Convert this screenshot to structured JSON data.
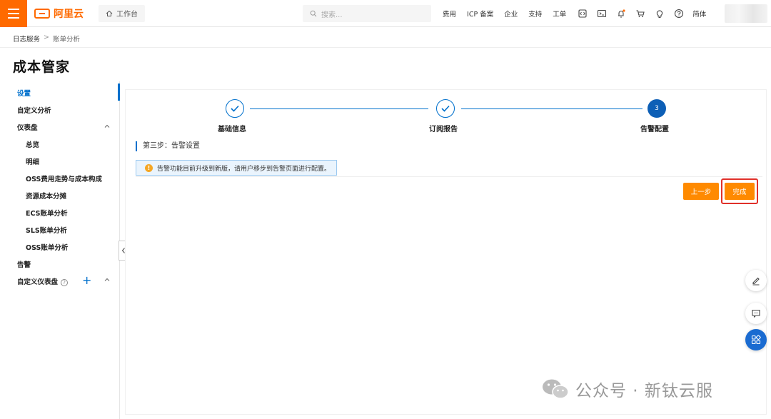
{
  "topbar": {
    "logo_text": "阿里云",
    "workbench": "工作台",
    "search_placeholder": "搜索...",
    "nav": [
      "费用",
      "ICP 备案",
      "企业",
      "支持",
      "工单"
    ],
    "lang": "简体"
  },
  "breadcrumb": {
    "root": "日志服务",
    "current": "账单分析"
  },
  "page_title": "成本管家",
  "sidebar": {
    "items": [
      {
        "label": "设置"
      },
      {
        "label": "自定义分析"
      },
      {
        "label": "仪表盘"
      },
      {
        "label": "总览"
      },
      {
        "label": "明细"
      },
      {
        "label": "OSS费用走势与成本构成"
      },
      {
        "label": "资源成本分摊"
      },
      {
        "label": "ECS账单分析"
      },
      {
        "label": "SLS账单分析"
      },
      {
        "label": "OSS账单分析"
      },
      {
        "label": "告警"
      },
      {
        "label": "自定义仪表盘"
      }
    ]
  },
  "steps": [
    {
      "label": "基础信息"
    },
    {
      "label": "订阅报告"
    },
    {
      "label": "告警配置",
      "number": "3"
    }
  ],
  "section_title": "第三步：告警设置",
  "alert_text": "告警功能目前升级到新版，请用户移步到告警页面进行配置。",
  "buttons": {
    "prev": "上一步",
    "finish": "完成"
  },
  "watermark": "公众号 · 新钛云服",
  "colors": {
    "brand": "#ff6a00",
    "primary": "#0070cc",
    "action": "#ff8a00",
    "highlight": "#e0302a"
  }
}
